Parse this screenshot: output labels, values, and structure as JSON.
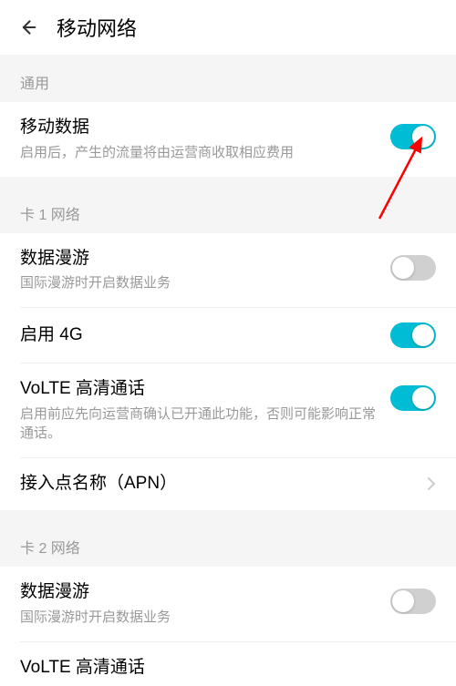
{
  "header": {
    "title": "移动网络"
  },
  "sections": {
    "general": {
      "label": "通用",
      "mobile_data": {
        "title": "移动数据",
        "subtitle": "启用后，产生的流量将由运营商收取相应费用",
        "enabled": true
      }
    },
    "sim1": {
      "label": "卡 1 网络",
      "data_roaming": {
        "title": "数据漫游",
        "subtitle": "国际漫游时开启数据业务",
        "enabled": false
      },
      "enable_4g": {
        "title": "启用 4G",
        "enabled": true
      },
      "volte": {
        "title": "VoLTE 高清通话",
        "subtitle": "启用前应先向运营商确认已开通此功能，否则可能影响正常通话。",
        "enabled": true
      },
      "apn": {
        "title": "接入点名称（APN）"
      }
    },
    "sim2": {
      "label": "卡 2 网络",
      "data_roaming": {
        "title": "数据漫游",
        "subtitle": "国际漫游时开启数据业务",
        "enabled": false
      },
      "volte": {
        "title": "VoLTE 高清通话"
      }
    }
  },
  "colors": {
    "accent": "#00bcd4",
    "arrow": "#ff0000"
  }
}
